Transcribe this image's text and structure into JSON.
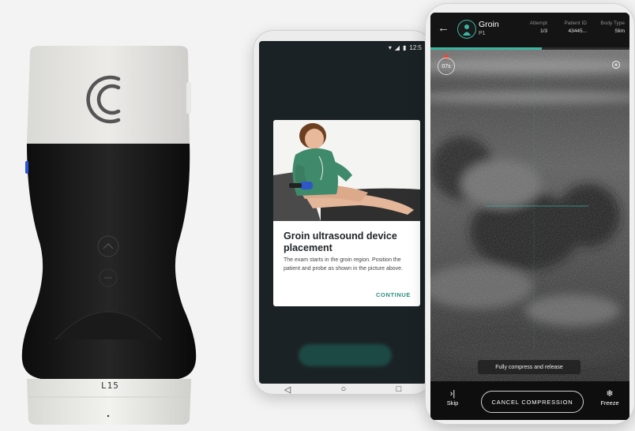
{
  "probe": {
    "model_label": "L15"
  },
  "phone_left": {
    "status_time": "12:5",
    "dialog": {
      "title": "Groin ultrasound device placement",
      "body": "The exam starts in the groin region. Position the patient and probe as shown in the picture above.",
      "continue_label": "CONTINUE"
    },
    "nav": {
      "back": "◁",
      "home": "○",
      "recents": "□"
    }
  },
  "phone_right": {
    "header": {
      "region": "Groin",
      "side": "P1",
      "attempt_label": "Attempt",
      "attempt_value": "1/3",
      "patient_id_label": "Patient ID",
      "patient_id_value": "43445...",
      "body_type_label": "Body Type",
      "body_type_value": "Slim"
    },
    "progress_fraction": 0.56,
    "timer": "07s",
    "hint": "Fully compress and release",
    "skip_label": "Skip",
    "cancel_label": "CANCEL COMPRESSION",
    "freeze_label": "Freeze"
  },
  "colors": {
    "accent": "#3ab5a1",
    "record": "#e24b3a"
  }
}
